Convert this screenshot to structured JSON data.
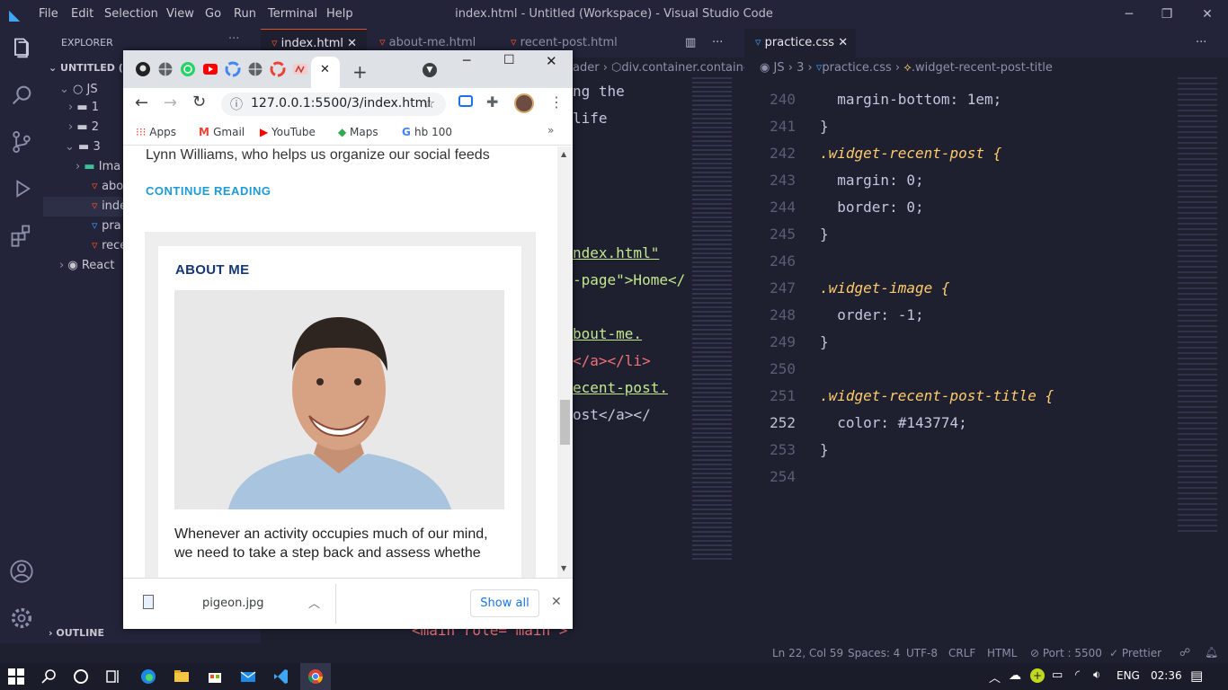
{
  "vscode": {
    "menu": [
      "File",
      "Edit",
      "Selection",
      "View",
      "Go",
      "Run",
      "Terminal",
      "Help"
    ],
    "title": "index.html - Untitled (Workspace) - Visual Studio Code",
    "explorer": {
      "header": "EXPLORER",
      "workspace": "UNTITLED (W",
      "items": [
        {
          "label": "JS"
        },
        {
          "label": "1"
        },
        {
          "label": "2"
        },
        {
          "label": "3"
        },
        {
          "label": "Ima"
        },
        {
          "label": "abo"
        },
        {
          "label": "inde"
        },
        {
          "label": "pra"
        },
        {
          "label": "rece"
        },
        {
          "label": "React"
        }
      ],
      "outline": "OUTLINE"
    },
    "editor1": {
      "tabs": [
        "index.html",
        "about-me.html",
        "recent-post.html"
      ],
      "breadcrumb_left": "ader",
      "breadcrumb": "div.container.container-",
      "fragments": [
        "ng the",
        "life",
        "ndex.html\"",
        "-page\">Home</",
        "bout-me.",
        "</a></li>",
        "ecent-post.",
        "ost</a></",
        "<main role=\"main\">"
      ]
    },
    "editor2": {
      "tab": "practice.css",
      "breadcrumb": [
        "JS",
        "3",
        "practice.css",
        ".widget-recent-post-title"
      ],
      "lines": [
        {
          "n": "240",
          "text": "  margin-bottom: 1em;"
        },
        {
          "n": "241",
          "text": "}"
        },
        {
          "n": "242",
          "text": ".widget-recent-post {"
        },
        {
          "n": "243",
          "text": "  margin: 0;"
        },
        {
          "n": "244",
          "text": "  border: 0;"
        },
        {
          "n": "245",
          "text": "}"
        },
        {
          "n": "246",
          "text": ""
        },
        {
          "n": "247",
          "text": ".widget-image {"
        },
        {
          "n": "248",
          "text": "  order: -1;"
        },
        {
          "n": "249",
          "text": "}"
        },
        {
          "n": "250",
          "text": ""
        },
        {
          "n": "251",
          "text": ".widget-recent-post-title {"
        },
        {
          "n": "252",
          "text": "  color: #143774;"
        },
        {
          "n": "253",
          "text": "}"
        },
        {
          "n": "254",
          "text": ""
        }
      ]
    },
    "status": [
      "Ln 22, Col 59",
      "Spaces: 4",
      "UTF-8",
      "CRLF",
      "HTML",
      "Port : 5500",
      "Prettier"
    ]
  },
  "chrome": {
    "url": "127.0.0.1:5500/3/index.html",
    "bookmarks": [
      "Apps",
      "Gmail",
      "YouTube",
      "Maps",
      "hb 100"
    ],
    "page": {
      "text_top": "Lynn Williams, who helps us organize our social feeds",
      "continue": "CONTINUE READING",
      "about_title": "ABOUT ME",
      "about_text": "Whenever an activity occupies much of our mind, we need to take a step back and assess whethe"
    },
    "download": {
      "file": "pigeon.jpg",
      "show_all": "Show all"
    }
  },
  "taskbar": {
    "lang": "ENG",
    "time": "02:36"
  },
  "colors": {
    "accent": "#1d9bd8",
    "heading": "#143774",
    "css_selector": "#ffcb6b",
    "css_value": "#f78c6c"
  }
}
